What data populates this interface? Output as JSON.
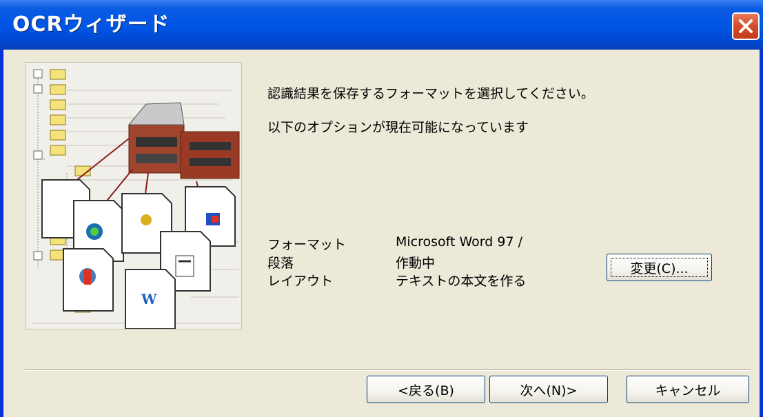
{
  "window": {
    "title": "OCRウィザード",
    "close_icon": "close-icon"
  },
  "main": {
    "prompt": "認識結果を保存するフォーマットを選択してください。",
    "subtitle": "以下のオプションが現在可能になっています",
    "settings": [
      {
        "label": "フォーマット",
        "value": "Microsoft Word 97 /"
      },
      {
        "label": "段落",
        "value": "作動中"
      },
      {
        "label": "レイアウト",
        "value": "テキストの本文を作る"
      }
    ],
    "change_button": "変更(C)..."
  },
  "footer": {
    "back_button": "<戻る(B)",
    "next_button": "次へ(N)>",
    "cancel_button": "キャンセル"
  },
  "colors": {
    "titlebar": "#0055e5",
    "client": "#ece9d8",
    "close": "#d34c2a"
  }
}
